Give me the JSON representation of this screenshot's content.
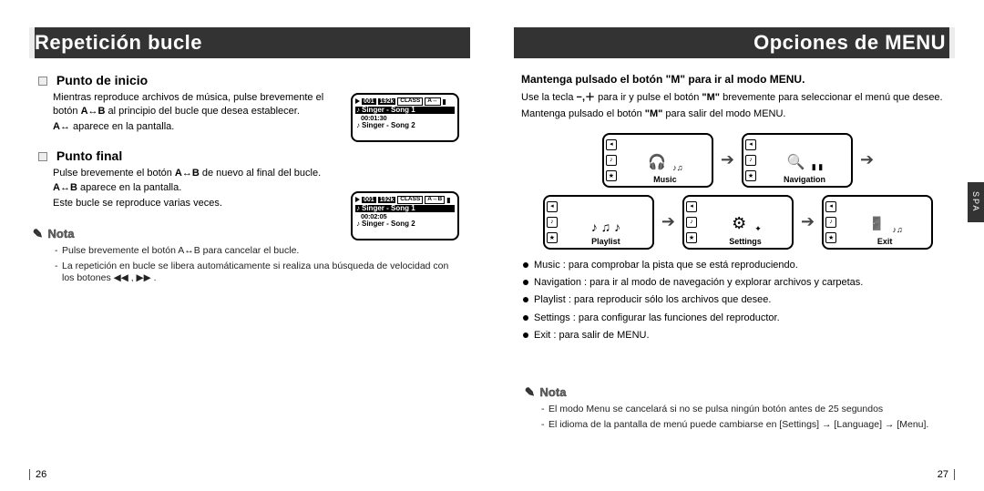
{
  "leftPage": {
    "header": "Repetición bucle",
    "section1": {
      "title": "Punto de inicio",
      "p1a": "Mientras reproduce archivos de música, pulse brevemente el botón ",
      "p1b": "A↔B",
      "p1c": " al principio del bucle que desea establecer.",
      "p2a": "A↔",
      "p2b": " aparece en la pantalla."
    },
    "section2": {
      "title": "Punto final",
      "p1a": "Pulse brevemente el botón ",
      "p1b": "A↔B",
      "p1c": " de nuevo al final del bucle.",
      "p2a": "A↔B",
      "p2b": " aparece en la pantalla.",
      "p3": "Este bucle se reproduce varias veces."
    },
    "noteHeading": "Nota",
    "notes": [
      "Pulse brevemente el botón A↔B para cancelar el bucle.",
      "La repetición en bucle se libera automáticamente si realiza una búsqueda de velocidad con los botones ◀◀ , ▶▶ ."
    ],
    "screen1": {
      "track_no": "001",
      "bitrate": "192k",
      "mode": "CLASS",
      "ab": "A↔",
      "row1": "Singer - Song 1",
      "time": "00:01:30",
      "row2": "Singer - Song 2"
    },
    "screen2": {
      "track_no": "001",
      "bitrate": "192k",
      "mode": "CLASS",
      "ab": "A↔B",
      "row1": "Singer - Song 1",
      "time": "00:02:05",
      "row2": "Singer - Song 2"
    },
    "pageNumber": "26"
  },
  "rightPage": {
    "header": "Opciones de MENU",
    "boldLine": "Mantenga pulsado el botón \"M\" para ir al modo MENU.",
    "p1a": "Use la tecla ",
    "p1b": "−,＋",
    "p1c": " para ir y pulse el botón ",
    "p1d": "\"M\"",
    "p1e": " brevemente para seleccionar el menú que desee.",
    "p2a": "Mantenga pulsado el botón ",
    "p2b": "\"M\"",
    "p2c": " para salir del modo MENU.",
    "menus": [
      "Music",
      "Navigation",
      "Playlist",
      "Settings",
      "Exit"
    ],
    "bullets": [
      "Music : para comprobar la pista que se está reproduciendo.",
      "Navigation : para ir al modo de navegación y explorar archivos y carpetas.",
      "Playlist : para reproducir sólo los archivos que desee.",
      "Settings : para configurar las funciones del reproductor.",
      "Exit : para salir de MENU."
    ],
    "noteHeading": "Nota",
    "notes": [
      "El modo Menu se cancelará si no se pulsa ningún botón antes de 25 segundos",
      "El idioma de la pantalla de menú puede cambiarse en [Settings] → [Language] → [Menu]."
    ],
    "spaTab": "SPA",
    "pageNumber": "27"
  }
}
